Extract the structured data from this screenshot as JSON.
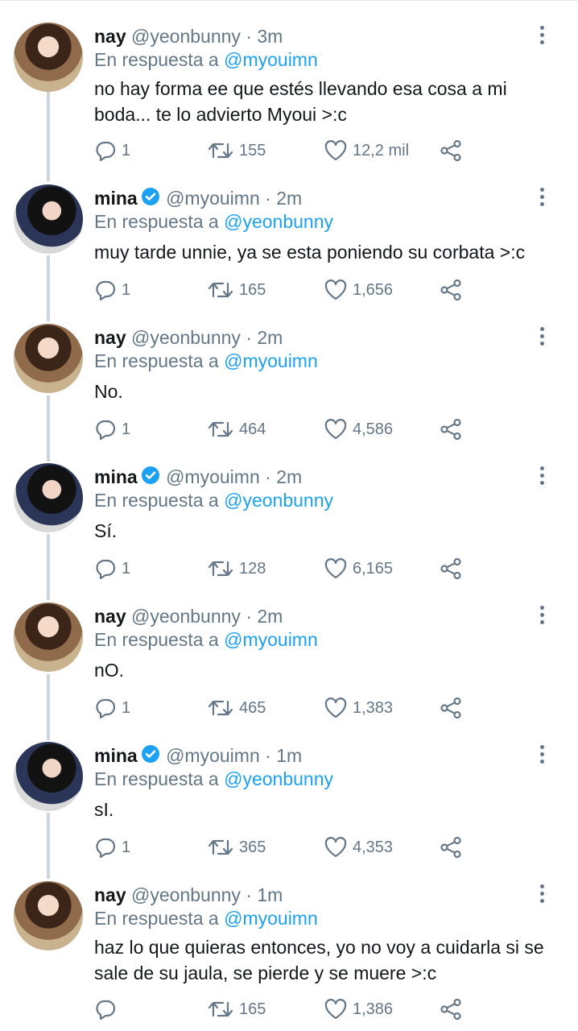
{
  "reply_prefix": "En respuesta a",
  "colors": {
    "link": "#1da1f2",
    "muted": "#657786",
    "text": "#14171a",
    "verified": "#1da1f2"
  },
  "tweets": [
    {
      "name": "nay",
      "verified": false,
      "handle": "@yeonbunny",
      "dot": "·",
      "time": "3m",
      "reply_to": "@myouimn",
      "text": "no hay forma ee que estés llevando esa cosa a mi boda... te lo advierto Myoui >:c",
      "replies": "1",
      "retweets": "155",
      "likes": "12,2 mil"
    },
    {
      "name": "mina",
      "verified": true,
      "handle": "@myouimn",
      "dot": "·",
      "time": "2m",
      "reply_to": "@yeonbunny",
      "text": "muy tarde unnie, ya se esta poniendo su corbata >:c",
      "replies": "1",
      "retweets": "165",
      "likes": "1,656"
    },
    {
      "name": "nay",
      "verified": false,
      "handle": "@yeonbunny",
      "dot": "·",
      "time": "2m",
      "reply_to": "@myouimn",
      "text": "No.",
      "replies": "1",
      "retweets": "464",
      "likes": "4,586"
    },
    {
      "name": "mina",
      "verified": true,
      "handle": "@myouimn",
      "dot": "·",
      "time": "2m",
      "reply_to": "@yeonbunny",
      "text": "Sí.",
      "replies": "1",
      "retweets": "128",
      "likes": "6,165"
    },
    {
      "name": "nay",
      "verified": false,
      "handle": "@yeonbunny",
      "dot": "·",
      "time": "2m",
      "reply_to": "@myouimn",
      "text": "nO.",
      "replies": "1",
      "retweets": "465",
      "likes": "1,383"
    },
    {
      "name": "mina",
      "verified": true,
      "handle": "@myouimn",
      "dot": "·",
      "time": "1m",
      "reply_to": "@yeonbunny",
      "text": "sI.",
      "replies": "1",
      "retweets": "365",
      "likes": "4,353"
    },
    {
      "name": "nay",
      "verified": false,
      "handle": "@yeonbunny",
      "dot": "·",
      "time": "1m",
      "reply_to": "@myouimn",
      "text": "haz lo que quieras entonces, yo no voy a cuidarla si se sale de su jaula, se pierde y se muere >:c",
      "replies": "",
      "retweets": "165",
      "likes": "1,386"
    }
  ]
}
